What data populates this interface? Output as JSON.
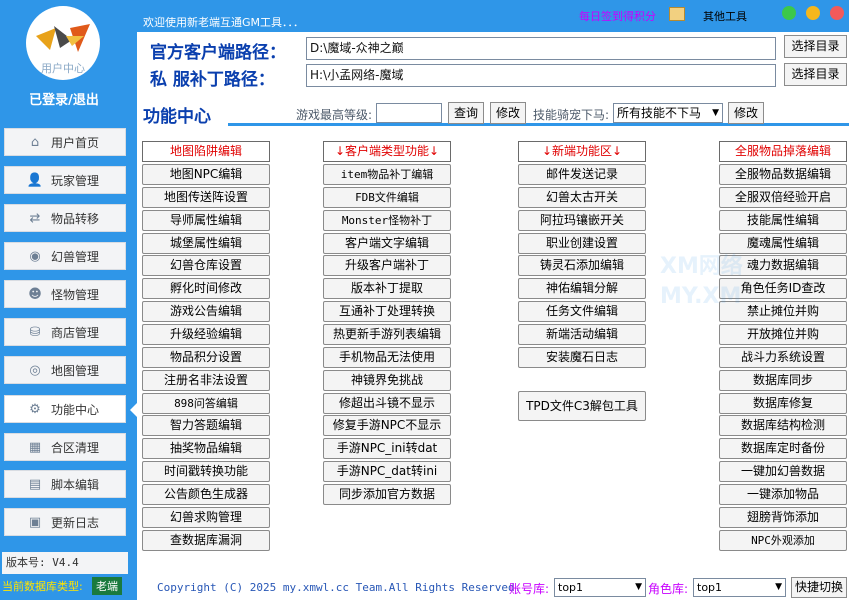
{
  "sidebar": {
    "logo_text": "用户中心",
    "login_status": "已登录/退出",
    "items": [
      {
        "label": "用户首页",
        "icon": "home-icon",
        "glyph": "⌂"
      },
      {
        "label": "玩家管理",
        "icon": "user-icon",
        "glyph": "👤"
      },
      {
        "label": "物品转移",
        "icon": "transfer-icon",
        "glyph": "⇄"
      },
      {
        "label": "幻兽管理",
        "icon": "egg-icon",
        "glyph": "◉"
      },
      {
        "label": "怪物管理",
        "icon": "monster-icon",
        "glyph": "☻"
      },
      {
        "label": "商店管理",
        "icon": "shop-icon",
        "glyph": "⛁"
      },
      {
        "label": "地图管理",
        "icon": "compass-icon",
        "glyph": "◎"
      },
      {
        "label": "功能中心",
        "icon": "gear-icon",
        "glyph": "⚙"
      },
      {
        "label": "合区清理",
        "icon": "grid-icon",
        "glyph": "▦"
      },
      {
        "label": "脚本编辑",
        "icon": "document-icon",
        "glyph": "▤"
      },
      {
        "label": "更新日志",
        "icon": "message-icon",
        "glyph": "▣"
      }
    ],
    "version": "版本号: V4.4",
    "db_type_label": "当前数据库类型:",
    "db_type_value": "老端"
  },
  "topbar": {
    "welcome": "欢迎使用新老端互通GM工具．．．",
    "signin": "每日签到得积分",
    "other_tools": "其他工具",
    "colors": {
      "green": "#3cc84a",
      "yellow": "#f5b71c",
      "red": "#f25a5a"
    }
  },
  "paths": {
    "client_label": "官方客户端路径：",
    "client_value": "D:\\魔域-众神之巅",
    "patch_label": "私 服补丁路径：",
    "patch_value": "H:\\小孟网络-魔域",
    "select_label": "选择目录"
  },
  "func_center": {
    "title": "功能中心",
    "max_level_label": "游戏最高等级:",
    "query_label": "查询",
    "modify_label": "修改",
    "mount_label": "技能骑宠下马:",
    "mount_value": "所有技能不下马"
  },
  "columns": {
    "col1": {
      "header": "地图陷阱编辑",
      "items": [
        "地图NPC编辑",
        "地图传送阵设置",
        "导师属性编辑",
        "城堡属性编辑",
        "幻兽仓库设置",
        "孵化时间修改",
        "游戏公告编辑",
        "升级经验编辑",
        "物品积分设置",
        "注册名非法设置",
        "898问答编辑",
        "智力答题编辑",
        "抽奖物品编辑",
        "时间戳转换功能",
        "公告颜色生成器",
        "幻兽求购管理",
        "查数据库漏洞"
      ]
    },
    "col2": {
      "header": "↓客户端类型功能↓",
      "items": [
        "item物品补丁编辑",
        "FDB文件编辑",
        "Monster怪物补丁",
        "客户端文字编辑",
        "升级客户端补丁",
        "版本补丁提取",
        "互通补丁处理转换",
        "热更新手游列表编辑",
        "手机物品无法使用",
        "神镜界免挑战",
        "修超出斗镜不显示",
        "修复手游NPC不显示",
        "手游NPC_ini转dat",
        "手游NPC_dat转ini",
        "同步添加官方数据"
      ]
    },
    "col3": {
      "header": "↓新端功能区↓",
      "items": [
        "邮件发送记录",
        "幻兽太古开关",
        "阿拉玛镶嵌开关",
        "职业创建设置",
        "铸灵石添加编辑",
        "神佑编辑分解",
        "任务文件编辑",
        "新端活动编辑",
        "安装魔石日志"
      ],
      "tool": "TPD文件C3解包工具"
    },
    "col4": {
      "header": "全服物品掉落编辑",
      "items": [
        "全服物品数据编辑",
        "全服双倍经验开启",
        "技能属性编辑",
        "魔魂属性编辑",
        "魂力数据编辑",
        "角色任务ID查改",
        "禁止摊位并购",
        "开放摊位并购",
        "战斗力系统设置",
        "数据库同步",
        "数据库修复",
        "数据库结构检测",
        "数据库定时备份",
        "一键加幻兽数据",
        "一键添加物品",
        "翅膀背饰添加",
        "NPC外观添加"
      ]
    }
  },
  "watermark": [
    "XM网络",
    "MY.XM"
  ],
  "footer": {
    "copyright": "Copyright (C) 2025 my.xmwl.cc Team.All Rights Reserved.",
    "account_db_label": "账号库:",
    "account_db_value": "top1",
    "role_db_label": "角色库:",
    "role_db_value": "top1",
    "quick_switch": "快捷切换"
  }
}
